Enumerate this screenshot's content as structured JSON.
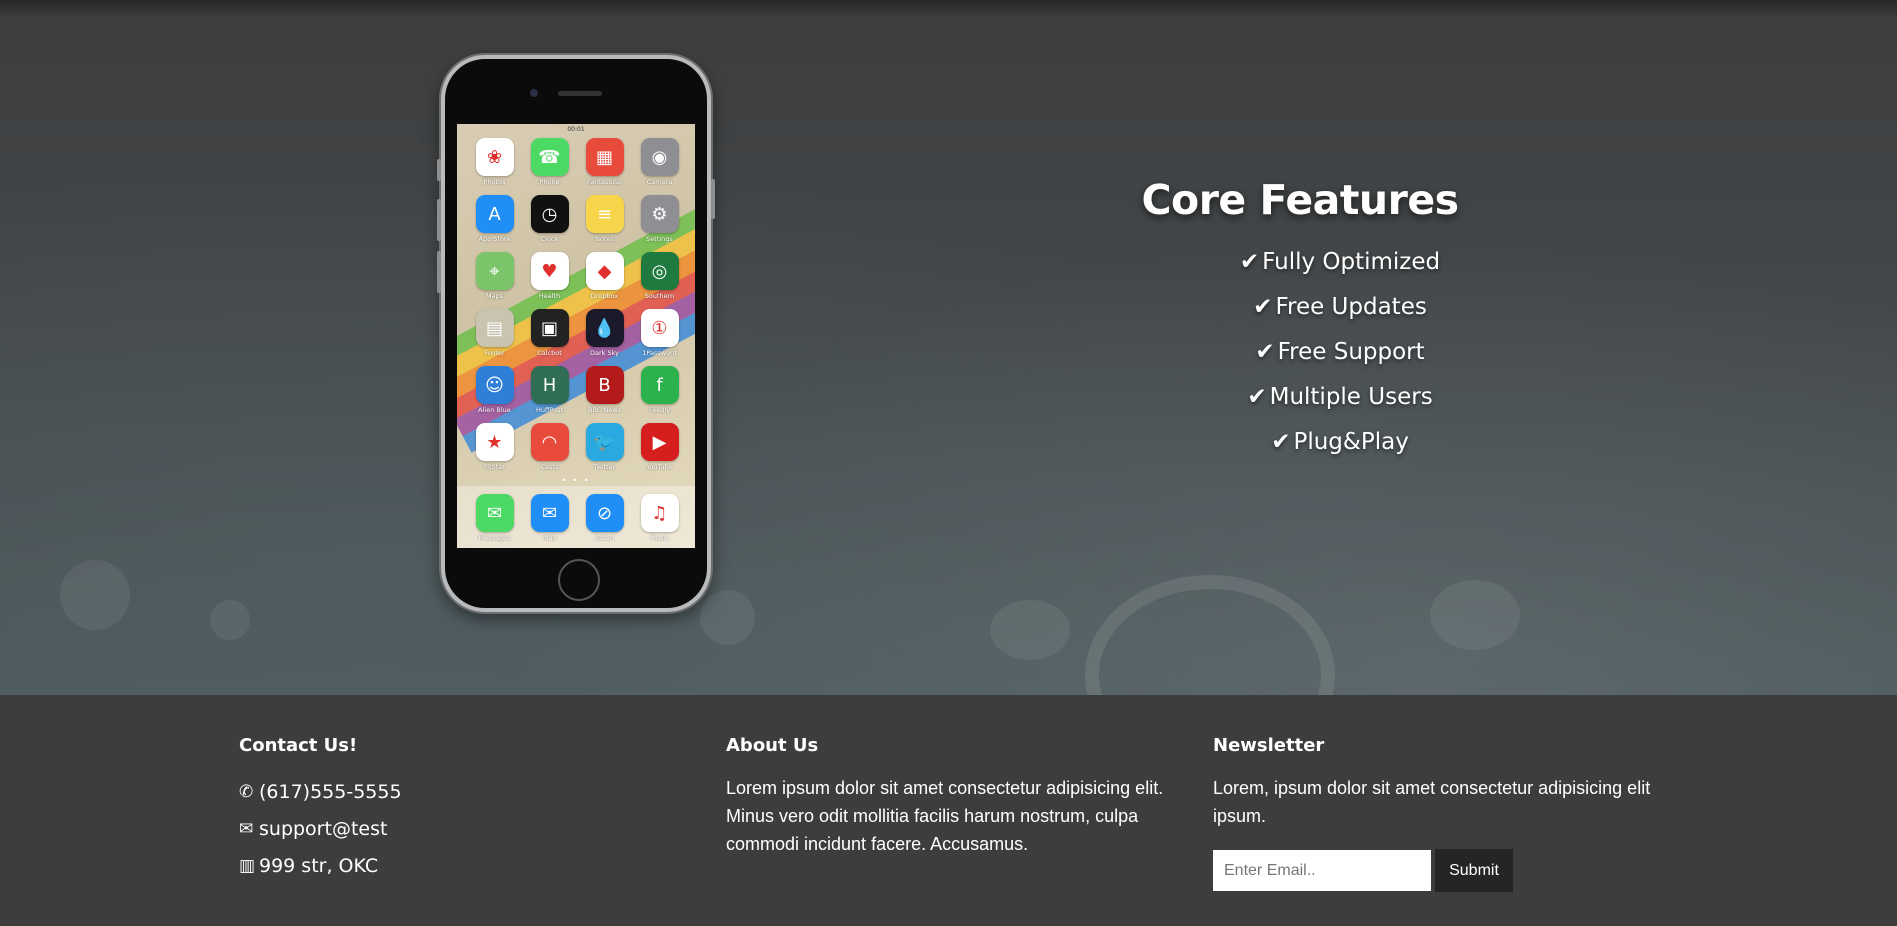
{
  "hero": {
    "phone_apps": [
      {
        "label": "Photos",
        "icon": "photos-icon",
        "color": "#ffffff",
        "glyph": "❀"
      },
      {
        "label": "Phone",
        "icon": "phone-icon",
        "color": "#4cd964",
        "glyph": "☎"
      },
      {
        "label": "Fantastical",
        "icon": "fantastical-icon",
        "color": "#e84a3c",
        "glyph": "▦"
      },
      {
        "label": "Camera",
        "icon": "camera-icon",
        "color": "#8e8e93",
        "glyph": "◉"
      },
      {
        "label": "App Store",
        "icon": "app-store-icon",
        "color": "#1f8ff7",
        "glyph": "A"
      },
      {
        "label": "Clock",
        "icon": "clock-icon",
        "color": "#111111",
        "glyph": "◷"
      },
      {
        "label": "Notes",
        "icon": "notes-icon",
        "color": "#f7d54a",
        "glyph": "≡"
      },
      {
        "label": "Settings",
        "icon": "settings-icon",
        "color": "#8e8e93",
        "glyph": "⚙"
      },
      {
        "label": "Maps",
        "icon": "maps-icon",
        "color": "#7cc46a",
        "glyph": "⌖"
      },
      {
        "label": "Health",
        "icon": "health-icon",
        "color": "#ffffff",
        "glyph": "♥"
      },
      {
        "label": "Dropbox",
        "icon": "dropbox-icon",
        "color": "#ffffff",
        "glyph": "◆"
      },
      {
        "label": "Southern",
        "icon": "southern-icon",
        "color": "#1f7a3f",
        "glyph": "◎"
      },
      {
        "label": "Folder",
        "icon": "folder-icon",
        "color": "#c9c3b0",
        "glyph": "▤"
      },
      {
        "label": "Calcbot",
        "icon": "calcbot-icon",
        "color": "#222222",
        "glyph": "▣"
      },
      {
        "label": "Dark Sky",
        "icon": "dark-sky-icon",
        "color": "#1a1a2a",
        "glyph": "💧"
      },
      {
        "label": "1Password",
        "icon": "1password-icon",
        "color": "#ffffff",
        "glyph": "①"
      },
      {
        "label": "Alien Blue",
        "icon": "alien-blue-icon",
        "color": "#2f7fd8",
        "glyph": "☺"
      },
      {
        "label": "HuffPost",
        "icon": "huffpost-icon",
        "color": "#2f6d55",
        "glyph": "H"
      },
      {
        "label": "BBC News",
        "icon": "bbc-news-icon",
        "color": "#b31b1b",
        "glyph": "B"
      },
      {
        "label": "Feedly",
        "icon": "feedly-icon",
        "color": "#2bb24c",
        "glyph": "f"
      },
      {
        "label": "FitStar",
        "icon": "fitstar-icon",
        "color": "#ffffff",
        "glyph": "★"
      },
      {
        "label": "Casts",
        "icon": "casts-icon",
        "color": "#e84a3c",
        "glyph": "◠"
      },
      {
        "label": "Twitter",
        "icon": "twitter-icon",
        "color": "#2aa9e0",
        "glyph": "🐦"
      },
      {
        "label": "YouTube",
        "icon": "youtube-icon",
        "color": "#d71e1e",
        "glyph": "▶"
      }
    ],
    "dock_apps": [
      {
        "label": "Messages",
        "icon": "messages-icon",
        "color": "#4cd964",
        "glyph": "✉"
      },
      {
        "label": "Mail",
        "icon": "mail-icon",
        "color": "#1f8ff7",
        "glyph": "✉"
      },
      {
        "label": "Safari",
        "icon": "safari-icon",
        "color": "#1f8ff7",
        "glyph": "⊘"
      },
      {
        "label": "Music",
        "icon": "music-icon",
        "color": "#ffffff",
        "glyph": "♫"
      }
    ],
    "status_time": "00:01",
    "features_title": "Core Features",
    "features": [
      "Fully Optimized",
      "Free Updates",
      "Free Support",
      "Multiple Users",
      "Plug&Play"
    ]
  },
  "footer": {
    "contact": {
      "title": "Contact Us!",
      "phone": "(617)555-5555",
      "email": "support@test",
      "address": "999 str, OKC"
    },
    "about": {
      "title": "About Us",
      "text": "Lorem ipsum dolor sit amet consectetur adipisicing elit. Minus vero odit mollitia facilis harum nostrum, culpa commodi incidunt facere. Accusamus."
    },
    "newsletter": {
      "title": "Newsletter",
      "text": "Lorem, ipsum dolor sit amet consectetur adipisicing elit ipsum.",
      "email_placeholder": "Enter Email..",
      "submit_label": "Submit"
    }
  }
}
